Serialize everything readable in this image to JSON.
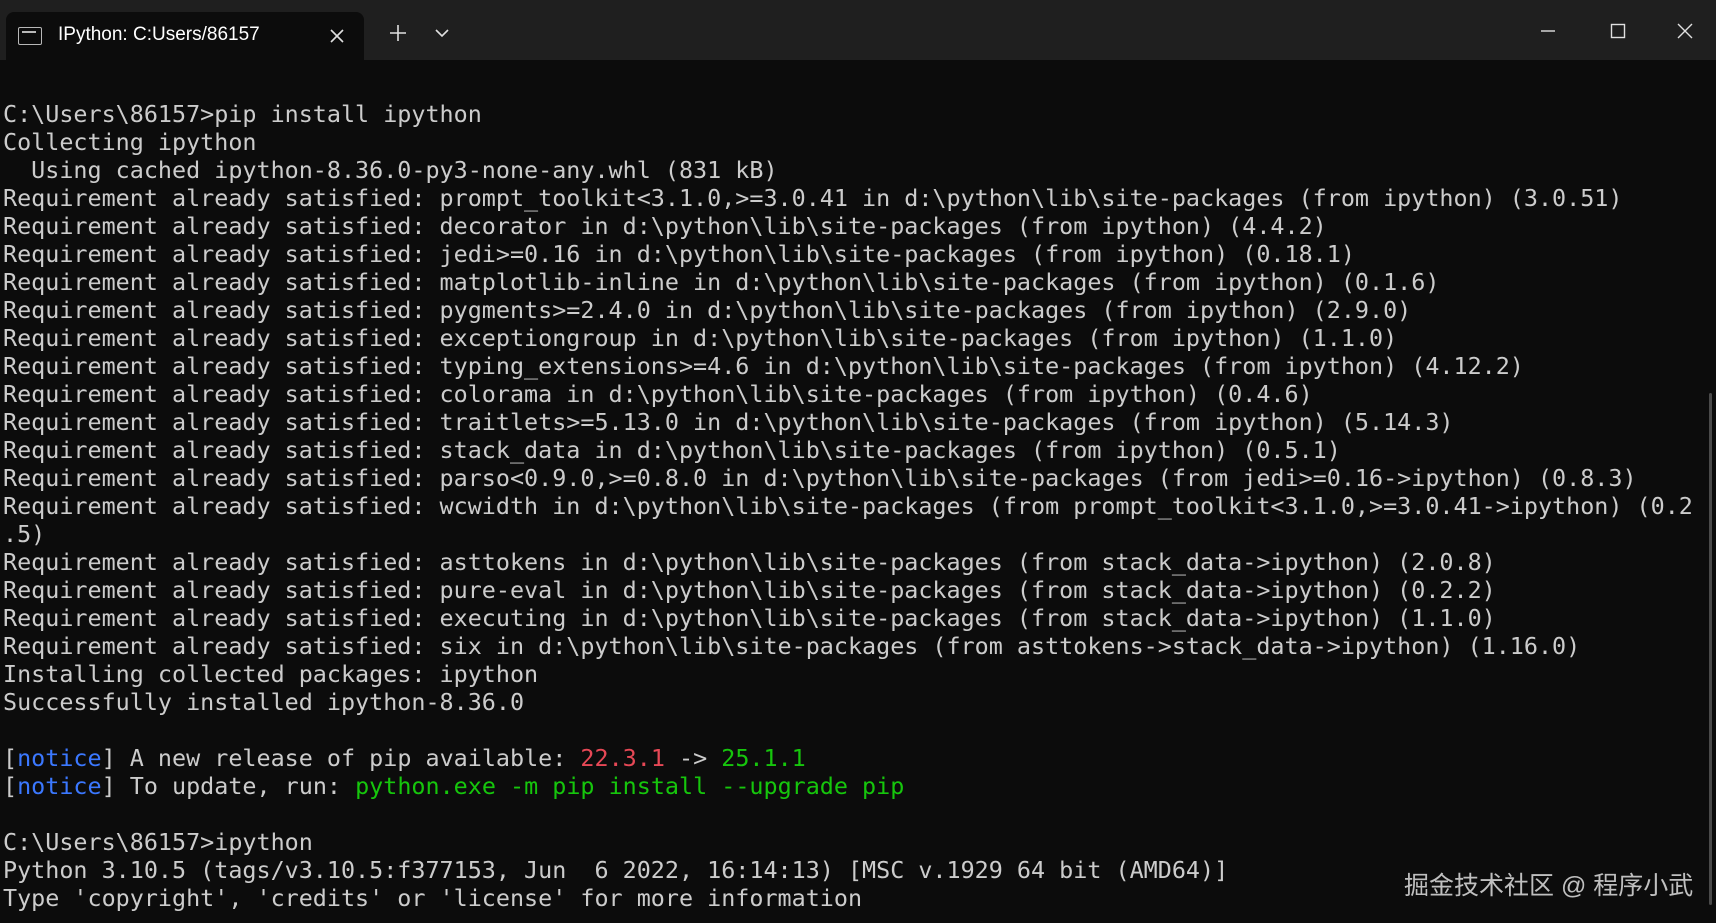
{
  "window": {
    "tab_title": "IPython: C:Users/86157",
    "icons": {
      "tab": "terminal-icon",
      "close_tab": "close-icon",
      "new_tab": "plus-icon",
      "dropdown": "chevron-down-icon",
      "minimize": "minimize-icon",
      "maximize": "maximize-icon",
      "close": "close-icon"
    }
  },
  "colors": {
    "background": "#0c0c0c",
    "text": "#cccccc",
    "red": "#e74856",
    "green": "#16c60c",
    "blue": "#3b78ff"
  },
  "console": {
    "lines": [
      "C:\\Users\\86157>pip install ipython",
      "Collecting ipython",
      "  Using cached ipython-8.36.0-py3-none-any.whl (831 kB)",
      "Requirement already satisfied: prompt_toolkit<3.1.0,>=3.0.41 in d:\\python\\lib\\site-packages (from ipython) (3.0.51)",
      "Requirement already satisfied: decorator in d:\\python\\lib\\site-packages (from ipython) (4.4.2)",
      "Requirement already satisfied: jedi>=0.16 in d:\\python\\lib\\site-packages (from ipython) (0.18.1)",
      "Requirement already satisfied: matplotlib-inline in d:\\python\\lib\\site-packages (from ipython) (0.1.6)",
      "Requirement already satisfied: pygments>=2.4.0 in d:\\python\\lib\\site-packages (from ipython) (2.9.0)",
      "Requirement already satisfied: exceptiongroup in d:\\python\\lib\\site-packages (from ipython) (1.1.0)",
      "Requirement already satisfied: typing_extensions>=4.6 in d:\\python\\lib\\site-packages (from ipython) (4.12.2)",
      "Requirement already satisfied: colorama in d:\\python\\lib\\site-packages (from ipython) (0.4.6)",
      "Requirement already satisfied: traitlets>=5.13.0 in d:\\python\\lib\\site-packages (from ipython) (5.14.3)",
      "Requirement already satisfied: stack_data in d:\\python\\lib\\site-packages (from ipython) (0.5.1)",
      "Requirement already satisfied: parso<0.9.0,>=0.8.0 in d:\\python\\lib\\site-packages (from jedi>=0.16->ipython) (0.8.3)",
      "Requirement already satisfied: wcwidth in d:\\python\\lib\\site-packages (from prompt_toolkit<3.1.0,>=3.0.41->ipython) (0.2",
      ".5)",
      "Requirement already satisfied: asttokens in d:\\python\\lib\\site-packages (from stack_data->ipython) (2.0.8)",
      "Requirement already satisfied: pure-eval in d:\\python\\lib\\site-packages (from stack_data->ipython) (0.2.2)",
      "Requirement already satisfied: executing in d:\\python\\lib\\site-packages (from stack_data->ipython) (1.1.0)",
      "Requirement already satisfied: six in d:\\python\\lib\\site-packages (from asttokens->stack_data->ipython) (1.16.0)",
      "Installing collected packages: ipython",
      "Successfully installed ipython-8.36.0"
    ],
    "notice1": {
      "open": "[",
      "tag": "notice",
      "close": "]",
      "text": " A new release of pip available: ",
      "old_version": "22.3.1",
      "arrow": " -> ",
      "new_version": "25.1.1"
    },
    "notice2": {
      "open": "[",
      "tag": "notice",
      "close": "]",
      "text": " To update, run: ",
      "command": "python.exe -m pip install --upgrade pip"
    },
    "after_lines": [
      "C:\\Users\\86157>ipython",
      "Python 3.10.5 (tags/v3.10.5:f377153, Jun  6 2022, 16:14:13) [MSC v.1929 64 bit (AMD64)]",
      "Type 'copyright', 'credits' or 'license' for more information"
    ]
  },
  "watermark": "掘金技术社区 @ 程序小武"
}
